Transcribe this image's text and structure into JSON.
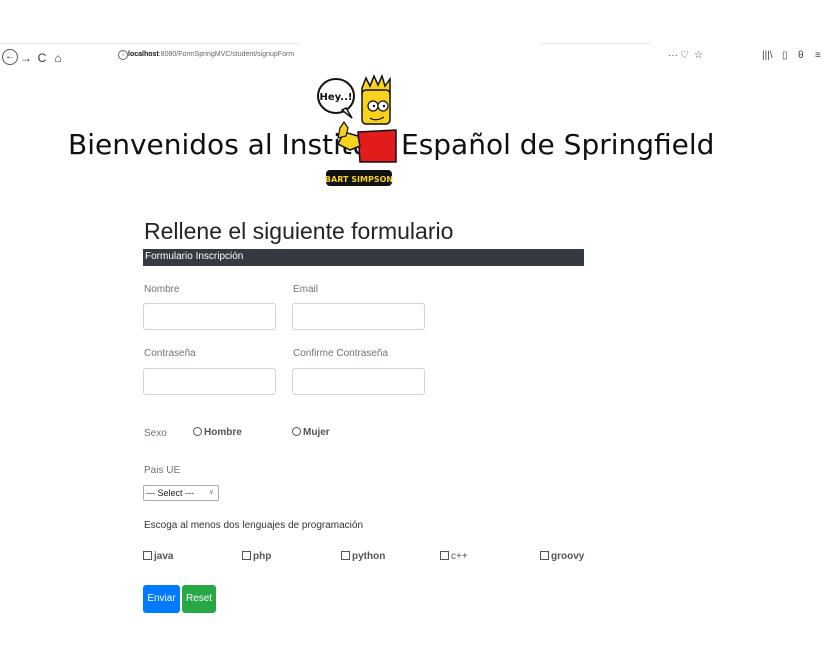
{
  "browser": {
    "url_host": "localhost",
    "url_path": ":8080/FormSpringMVC/student/signupForm",
    "back_glyph": "←",
    "forward_glyph": "→",
    "reload_glyph": "C",
    "home_glyph": "⌂",
    "info_glyph": "i",
    "more_glyph": "···",
    "pocket_glyph": "♡",
    "star_glyph": "☆",
    "library_glyph": "|||\\",
    "sidebar_glyph": "▯",
    "account_glyph": "θ",
    "menu_glyph": "≡"
  },
  "hero": {
    "text_left": "Bienvenidos al Instituto",
    "text_right": "Español de Springfield",
    "bubble_text": "Hey..!",
    "logo_text": "BART SIMPSON"
  },
  "form": {
    "title": "Rellene el siguiente formulario",
    "section_label": "Formulario Inscripción",
    "fields": {
      "nombre": {
        "label": "Nombre",
        "value": ""
      },
      "email": {
        "label": "Email",
        "value": ""
      },
      "password": {
        "label": "Contraseña",
        "value": ""
      },
      "confirm_password": {
        "label": "Confirme Contraseña",
        "value": ""
      }
    },
    "sexo": {
      "label": "Sexo",
      "options": [
        "Hombre",
        "Mujer"
      ]
    },
    "pais": {
      "label": "Pais UE",
      "selected": "--- Select ---"
    },
    "lenguajes": {
      "label": "Escoga al menos dos lenguajes de programación",
      "options": [
        "java",
        "php",
        "python",
        "c++",
        "groovy"
      ]
    },
    "buttons": {
      "submit": "Enviar",
      "reset": "Reset"
    }
  },
  "colors": {
    "section_bar": "#343a40",
    "submit_button": "#007bff",
    "reset_button": "#28a745"
  }
}
